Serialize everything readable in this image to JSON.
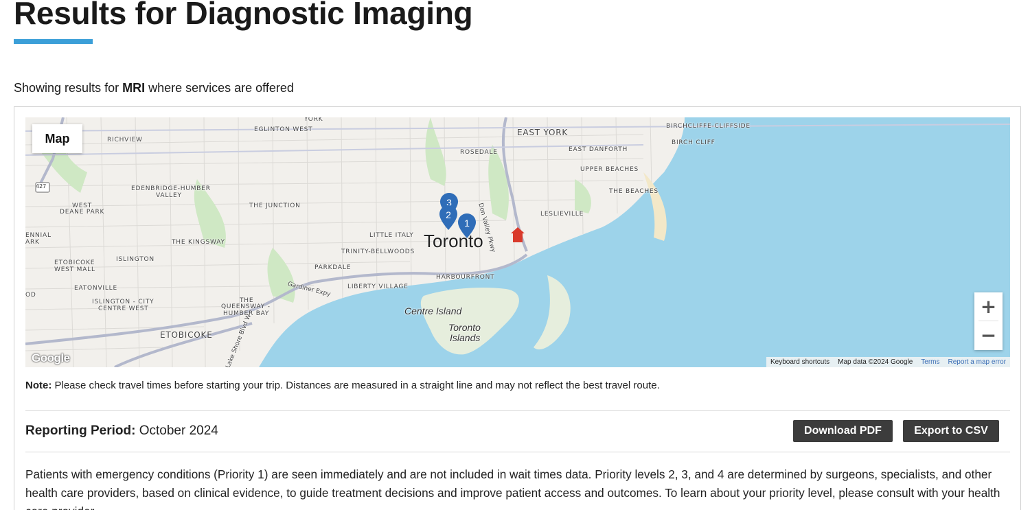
{
  "page": {
    "title": "Results for Diagnostic Imaging",
    "showing_prefix": "Showing results for",
    "service": "MRI",
    "showing_suffix": "where services are offered"
  },
  "map": {
    "type_button": "Map",
    "zoom_in": "+",
    "zoom_out": "−",
    "google_logo": "Google",
    "attribution": {
      "keyboard": "Keyboard shortcuts",
      "data": "Map data ©2024 Google",
      "terms": "Terms",
      "report": "Report a map error"
    },
    "labels": {
      "york": "YORK",
      "eglinton_west": "EGLINTON WEST",
      "richview": "RICHVIEW",
      "rosedale": "ROSEDALE",
      "east_york": "EAST YORK",
      "east_danforth": "EAST DANFORTH",
      "birchcliffe": "BIRCHCLIFFE-CLIFFSIDE",
      "birch_cliff": "BIRCH CLIFF",
      "upper_beaches": "UPPER BEACHES",
      "the_beaches": "THE BEACHES",
      "edenbridge": "EDENBRIDGE-HUMBER",
      "valley": "VALLEY",
      "the_junction": "THE JUNCTION",
      "west": "WEST",
      "deane_park": "DEANE PARK",
      "leslieville": "LESLIEVILLE",
      "ennial": "ENNIAL",
      "ark": "ARK",
      "little_italy": "LITTLE ITALY",
      "the_kingsway": "THE KINGSWAY",
      "toronto": "Toronto",
      "trinity": "TRINITY-BELLWOODS",
      "etobicoke_west_mall_1": "ETOBICOKE",
      "etobicoke_west_mall_2": "WEST MALL",
      "islington": "ISLINGTON",
      "parkdale": "PARKDALE",
      "harbourfront": "HARBOURFRONT",
      "eatonville": "EATONVILLE",
      "liberty_village": "LIBERTY VILLAGE",
      "od": "OD",
      "islington_city_1": "ISLINGTON - CITY",
      "islington_city_2": "CENTRE WEST",
      "queensway_1": "THE",
      "queensway_2": "QUEENSWAY -",
      "queensway_3": "HUMBER BAY",
      "centre_island": "Centre Island",
      "toronto_islands_1": "Toronto",
      "toronto_islands_2": "Islands",
      "etobicoke": "ETOBICOKE",
      "gardiner": "Gardiner Expy",
      "don_valley": "Don Valley Pkwy",
      "lake_shore": "Lake Shore Blvd W",
      "hwy_427": "427"
    },
    "pins": [
      {
        "label": "3"
      },
      {
        "label": "2"
      },
      {
        "label": "1"
      }
    ],
    "colors": {
      "water": "#9dd3ea",
      "pin": "#2f6db8",
      "home": "#d93a2b",
      "land": "#f2f0ec",
      "park": "#cfe8c4"
    }
  },
  "note": {
    "label": "Note:",
    "text": "Please check travel times before starting your trip. Distances are measured in a straight line and may not reflect the best travel route."
  },
  "report": {
    "label": "Reporting Period:",
    "value": "October 2024",
    "download_pdf": "Download PDF",
    "export_csv": "Export to CSV"
  },
  "paragraph": "Patients with emergency conditions (Priority 1) are seen immediately and are not included in wait times data. Priority levels 2, 3, and 4 are determined by surgeons, specialists, and other health care providers, based on clinical evidence, to guide treatment decisions and improve patient access and outcomes. To learn about your priority level, please consult with your health care provider."
}
